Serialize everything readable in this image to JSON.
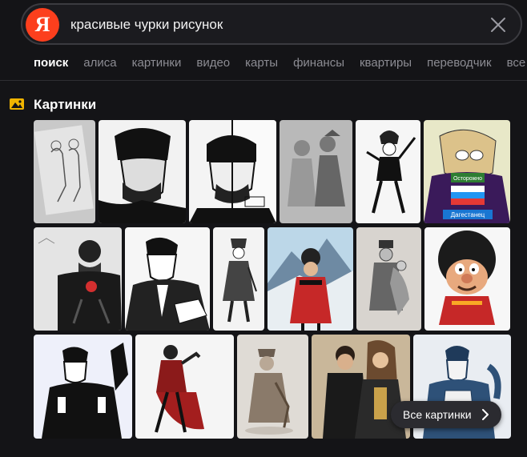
{
  "search": {
    "logo_letter": "Я",
    "query": "красивые чурки рисунок"
  },
  "tabs": [
    {
      "label": "поиск",
      "active": true
    },
    {
      "label": "алиса",
      "active": false
    },
    {
      "label": "картинки",
      "active": false
    },
    {
      "label": "видео",
      "active": false
    },
    {
      "label": "карты",
      "active": false
    },
    {
      "label": "финансы",
      "active": false
    },
    {
      "label": "квартиры",
      "active": false
    },
    {
      "label": "переводчик",
      "active": false
    },
    {
      "label": "все",
      "active": false
    }
  ],
  "images_section": {
    "icon": "image-icon",
    "title": "Картинки",
    "all_button_label": "Все картинки",
    "thumbnails": [
      {
        "caption": "",
        "theme": "sketch-gray"
      },
      {
        "caption": "",
        "theme": "bw-man-beanie"
      },
      {
        "caption": "",
        "theme": "bw-split-face"
      },
      {
        "caption": "",
        "theme": "pencil-couple"
      },
      {
        "caption": "",
        "theme": "bw-dancer"
      },
      {
        "caption": "Осторожно",
        "caption2": "Дагестанец",
        "theme": "cartoon-dagestan"
      },
      {
        "caption": "",
        "theme": "bearded-man-dark"
      },
      {
        "caption": "",
        "theme": "bw-man-suit"
      },
      {
        "caption": "",
        "theme": "ink-standing"
      },
      {
        "caption": "",
        "theme": "mountain-red-coat"
      },
      {
        "caption": "",
        "theme": "pencil-couple-2"
      },
      {
        "caption": "",
        "theme": "cartoon-papakha"
      },
      {
        "caption": "",
        "theme": "bw-dancer-2"
      },
      {
        "caption": "",
        "theme": "red-coat-dancer"
      },
      {
        "caption": "",
        "theme": "sepia-figure"
      },
      {
        "caption": "",
        "theme": "couple-photo"
      },
      {
        "caption": "",
        "theme": "blue-muscle"
      }
    ]
  },
  "colors": {
    "background": "#141417",
    "brand_red": "#fc3f1d",
    "tab_inactive": "#8c8c93",
    "tab_active": "#ffffff"
  }
}
